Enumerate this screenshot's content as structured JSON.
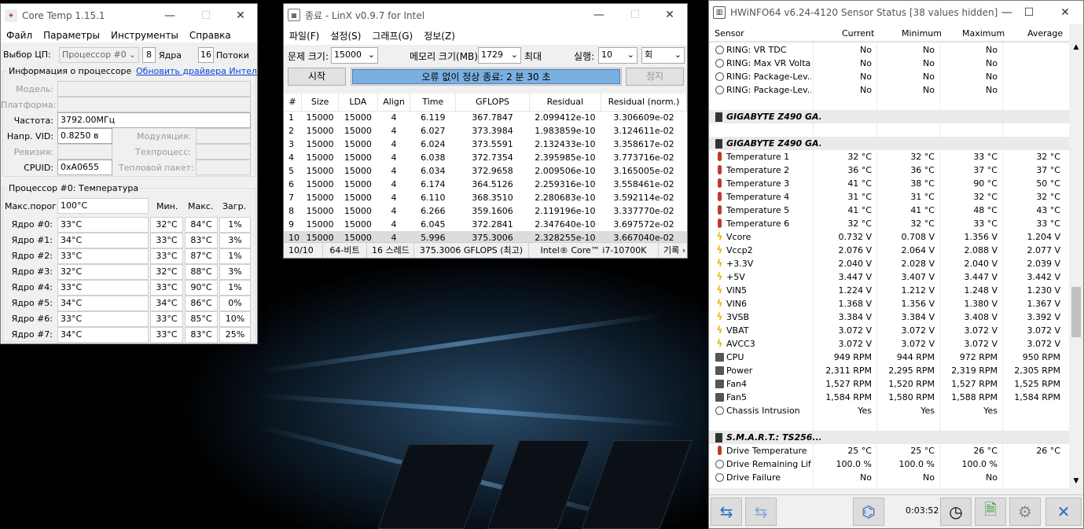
{
  "coretemp": {
    "title": "Core Temp 1.15.1",
    "menu": [
      "Файл",
      "Параметры",
      "Инструменты",
      "Справка"
    ],
    "cpu_select_label": "Выбор ЦП:",
    "cpu_select_value": "Процессор #0",
    "cores_count": "8",
    "cores_label": "Ядра",
    "threads_count": "16",
    "threads_label": "Потоки",
    "info_group": "Информация о процессоре",
    "driver_link": "Обновить драйвера Интель",
    "model_label": "Модель:",
    "platform_label": "Платформа:",
    "freq_label": "Частота:",
    "freq_value": "3792.00МГц",
    "vid_label": "Напр. VID:",
    "vid_value": "0.8250 в",
    "modulation_label": "Модуляция:",
    "revision_label": "Ревизия:",
    "process_label": "Техпроцесс:",
    "cpuid_label": "CPUID:",
    "cpuid_value": "0xA0655",
    "tdp_label": "Тепловой пакет:",
    "temp_group": "Процессор #0: Температура",
    "tjmax_label": "Макс.порог:",
    "tjmax_value": "100°C",
    "col_min": "Мин.",
    "col_max": "Макс.",
    "col_load": "Загр.",
    "cores": [
      {
        "label": "Ядро #0:",
        "temp": "33°C",
        "min": "32°C",
        "max": "84°C",
        "load": "1%"
      },
      {
        "label": "Ядро #1:",
        "temp": "34°C",
        "min": "33°C",
        "max": "83°C",
        "load": "3%"
      },
      {
        "label": "Ядро #2:",
        "temp": "33°C",
        "min": "33°C",
        "max": "87°C",
        "load": "1%"
      },
      {
        "label": "Ядро #3:",
        "temp": "32°C",
        "min": "32°C",
        "max": "88°C",
        "load": "3%"
      },
      {
        "label": "Ядро #4:",
        "temp": "33°C",
        "min": "33°C",
        "max": "90°C",
        "load": "1%"
      },
      {
        "label": "Ядро #5:",
        "temp": "34°C",
        "min": "34°C",
        "max": "86°C",
        "load": "0%"
      },
      {
        "label": "Ядро #6:",
        "temp": "33°C",
        "min": "33°C",
        "max": "85°C",
        "load": "10%"
      },
      {
        "label": "Ядро #7:",
        "temp": "34°C",
        "min": "33°C",
        "max": "83°C",
        "load": "25%"
      }
    ]
  },
  "linx": {
    "title": "종료 - LinX v0.9.7 for Intel",
    "menu": [
      "파일(F)",
      "설정(S)",
      "그래프(G)",
      "정보(Z)"
    ],
    "problem_label": "문제 크기:",
    "problem_value": "15000",
    "memory_label": "메모리 크기(MB):",
    "memory_value": "1729",
    "max_label": "최대",
    "run_label": "실행:",
    "run_value": "10",
    "run_unit": "회",
    "start_button": "시작",
    "progress_text": "오류 없이 정상 종료: 2 분 30 초",
    "progress_fraction": 1.0,
    "stop_button": "정지",
    "columns": [
      "#",
      "Size",
      "LDA",
      "Align",
      "Time",
      "GFLOPS",
      "Residual",
      "Residual (norm.)"
    ],
    "rows": [
      [
        "1",
        "15000",
        "15000",
        "4",
        "6.119",
        "367.7847",
        "2.099412e-10",
        "3.306609e-02"
      ],
      [
        "2",
        "15000",
        "15000",
        "4",
        "6.027",
        "373.3984",
        "1.983859e-10",
        "3.124611e-02"
      ],
      [
        "3",
        "15000",
        "15000",
        "4",
        "6.024",
        "373.5591",
        "2.132433e-10",
        "3.358617e-02"
      ],
      [
        "4",
        "15000",
        "15000",
        "4",
        "6.038",
        "372.7354",
        "2.395985e-10",
        "3.773716e-02"
      ],
      [
        "5",
        "15000",
        "15000",
        "4",
        "6.034",
        "372.9658",
        "2.009506e-10",
        "3.165005e-02"
      ],
      [
        "6",
        "15000",
        "15000",
        "4",
        "6.174",
        "364.5126",
        "2.259316e-10",
        "3.558461e-02"
      ],
      [
        "7",
        "15000",
        "15000",
        "4",
        "6.110",
        "368.3510",
        "2.280683e-10",
        "3.592114e-02"
      ],
      [
        "8",
        "15000",
        "15000",
        "4",
        "6.266",
        "359.1606",
        "2.119196e-10",
        "3.337770e-02"
      ],
      [
        "9",
        "15000",
        "15000",
        "4",
        "6.045",
        "372.2841",
        "2.347640e-10",
        "3.697572e-02"
      ],
      [
        "10",
        "15000",
        "15000",
        "4",
        "5.996",
        "375.3006",
        "2.328255e-10",
        "3.667040e-02"
      ]
    ],
    "status": [
      "10/10",
      "64-비트",
      "16 스레드",
      "375.3006 GFLOPS (최고)",
      "Intel® Core™ i7-10700K",
      "기록 ›"
    ]
  },
  "hwinfo": {
    "title": "HWiNFO64 v6.24-4120 Sensor Status [38 values hidden]",
    "columns": [
      "Sensor",
      "Current",
      "Minimum",
      "Maximum",
      "Average"
    ],
    "rows": [
      {
        "icon": "clock-icon",
        "name": "RING: VR TDC",
        "cur": "No",
        "min": "No",
        "max": "No",
        "avg": ""
      },
      {
        "icon": "clock-icon",
        "name": "RING: Max VR Volta...",
        "cur": "No",
        "min": "No",
        "max": "No",
        "avg": ""
      },
      {
        "icon": "clock-icon",
        "name": "RING: Package-Lev...",
        "cur": "No",
        "min": "No",
        "max": "No",
        "avg": ""
      },
      {
        "icon": "clock-icon",
        "name": "RING: Package-Lev...",
        "cur": "No",
        "min": "No",
        "max": "No",
        "avg": ""
      },
      {
        "icon": "",
        "name": "",
        "cur": "",
        "min": "",
        "max": "",
        "avg": ""
      },
      {
        "icon": "chip-icon",
        "name": "GIGABYTE Z490 GA...",
        "group": true,
        "cur": "",
        "min": "",
        "max": "",
        "avg": ""
      },
      {
        "icon": "",
        "name": "",
        "cur": "",
        "min": "",
        "max": "",
        "avg": ""
      },
      {
        "icon": "chip-icon",
        "name": "GIGABYTE Z490 GA...",
        "group": true,
        "cur": "",
        "min": "",
        "max": "",
        "avg": ""
      },
      {
        "icon": "thermometer-icon",
        "name": "Temperature 1",
        "cur": "32 °C",
        "min": "32 °C",
        "max": "33 °C",
        "avg": "32 °C"
      },
      {
        "icon": "thermometer-icon",
        "name": "Temperature 2",
        "cur": "36 °C",
        "min": "36 °C",
        "max": "37 °C",
        "avg": "37 °C"
      },
      {
        "icon": "thermometer-icon",
        "name": "Temperature 3",
        "cur": "41 °C",
        "min": "38 °C",
        "max": "90 °C",
        "avg": "50 °C"
      },
      {
        "icon": "thermometer-icon",
        "name": "Temperature 4",
        "cur": "31 °C",
        "min": "31 °C",
        "max": "32 °C",
        "avg": "32 °C"
      },
      {
        "icon": "thermometer-icon",
        "name": "Temperature 5",
        "cur": "41 °C",
        "min": "41 °C",
        "max": "48 °C",
        "avg": "43 °C"
      },
      {
        "icon": "thermometer-icon",
        "name": "Temperature 6",
        "cur": "32 °C",
        "min": "32 °C",
        "max": "33 °C",
        "avg": "33 °C"
      },
      {
        "icon": "bolt-icon",
        "name": "Vcore",
        "cur": "0.732 V",
        "min": "0.708 V",
        "max": "1.356 V",
        "avg": "1.204 V"
      },
      {
        "icon": "bolt-icon",
        "name": "Vccp2",
        "cur": "2.076 V",
        "min": "2.064 V",
        "max": "2.088 V",
        "avg": "2.077 V"
      },
      {
        "icon": "bolt-icon",
        "name": "+3.3V",
        "cur": "2.040 V",
        "min": "2.028 V",
        "max": "2.040 V",
        "avg": "2.039 V"
      },
      {
        "icon": "bolt-icon",
        "name": "+5V",
        "cur": "3.447 V",
        "min": "3.407 V",
        "max": "3.447 V",
        "avg": "3.442 V"
      },
      {
        "icon": "bolt-icon",
        "name": "VIN5",
        "cur": "1.224 V",
        "min": "1.212 V",
        "max": "1.248 V",
        "avg": "1.230 V"
      },
      {
        "icon": "bolt-icon",
        "name": "VIN6",
        "cur": "1.368 V",
        "min": "1.356 V",
        "max": "1.380 V",
        "avg": "1.367 V"
      },
      {
        "icon": "bolt-icon",
        "name": "3VSB",
        "cur": "3.384 V",
        "min": "3.384 V",
        "max": "3.408 V",
        "avg": "3.392 V"
      },
      {
        "icon": "bolt-icon",
        "name": "VBAT",
        "cur": "3.072 V",
        "min": "3.072 V",
        "max": "3.072 V",
        "avg": "3.072 V"
      },
      {
        "icon": "bolt-icon",
        "name": "AVCC3",
        "cur": "3.072 V",
        "min": "3.072 V",
        "max": "3.072 V",
        "avg": "3.072 V"
      },
      {
        "icon": "fan-icon",
        "name": "CPU",
        "cur": "949 RPM",
        "min": "944 RPM",
        "max": "972 RPM",
        "avg": "950 RPM"
      },
      {
        "icon": "fan-icon",
        "name": "Power",
        "cur": "2,311 RPM",
        "min": "2,295 RPM",
        "max": "2,319 RPM",
        "avg": "2,305 RPM"
      },
      {
        "icon": "fan-icon",
        "name": "Fan4",
        "cur": "1,527 RPM",
        "min": "1,520 RPM",
        "max": "1,527 RPM",
        "avg": "1,525 RPM"
      },
      {
        "icon": "fan-icon",
        "name": "Fan5",
        "cur": "1,584 RPM",
        "min": "1,580 RPM",
        "max": "1,588 RPM",
        "avg": "1,584 RPM"
      },
      {
        "icon": "clock-icon",
        "name": "Chassis Intrusion",
        "cur": "Yes",
        "min": "Yes",
        "max": "Yes",
        "avg": ""
      },
      {
        "icon": "",
        "name": "",
        "cur": "",
        "min": "",
        "max": "",
        "avg": ""
      },
      {
        "icon": "chip-icon",
        "name": "S.M.A.R.T.: TS256...",
        "group": true,
        "cur": "",
        "min": "",
        "max": "",
        "avg": ""
      },
      {
        "icon": "thermometer-icon",
        "name": "Drive Temperature",
        "cur": "25 °C",
        "min": "25 °C",
        "max": "26 °C",
        "avg": "26 °C"
      },
      {
        "icon": "clock-icon",
        "name": "Drive Remaining Life",
        "cur": "100.0 %",
        "min": "100.0 %",
        "max": "100.0 %",
        "avg": ""
      },
      {
        "icon": "clock-icon",
        "name": "Drive Failure",
        "cur": "No",
        "min": "No",
        "max": "No",
        "avg": ""
      }
    ],
    "elapsed": "0:03:52"
  }
}
